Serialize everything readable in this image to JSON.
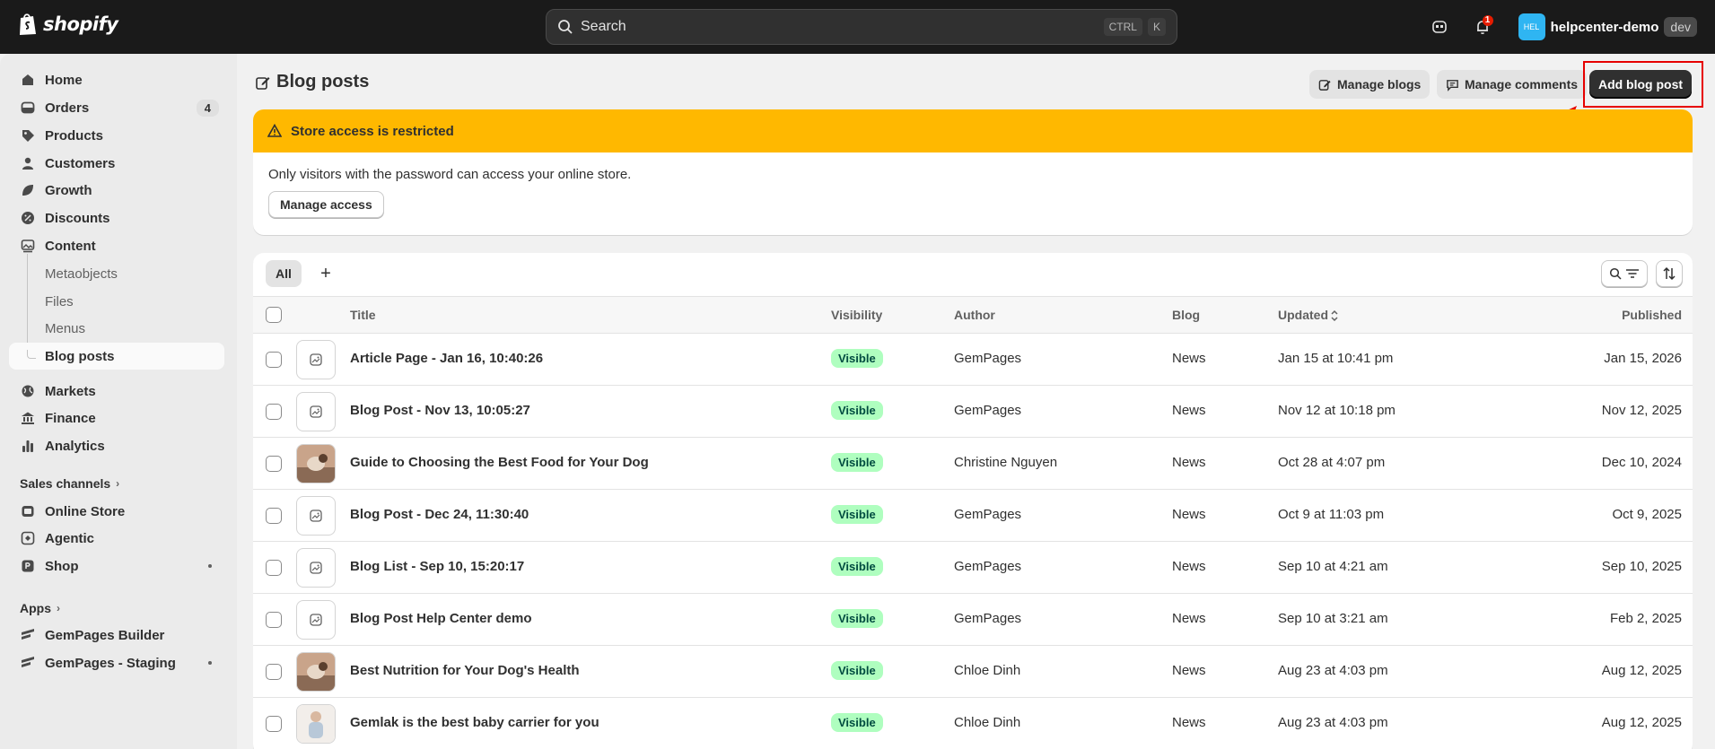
{
  "topbar": {
    "logo_text": "shopify",
    "search_placeholder": "Search",
    "kbd_ctrl": "CTRL",
    "kbd_k": "K",
    "notification_count": "1",
    "store_initials": "HEL",
    "store_name": "helpcenter-demo",
    "store_tag": "dev"
  },
  "sidebar": {
    "items": [
      {
        "label": "Home",
        "icon": "home-icon"
      },
      {
        "label": "Orders",
        "icon": "orders-icon",
        "badge": "4"
      },
      {
        "label": "Products",
        "icon": "tag-icon"
      },
      {
        "label": "Customers",
        "icon": "person-icon"
      },
      {
        "label": "Growth",
        "icon": "growth-icon"
      },
      {
        "label": "Discounts",
        "icon": "discount-icon"
      },
      {
        "label": "Content",
        "icon": "content-icon"
      }
    ],
    "content_sub": [
      "Metaobjects",
      "Files",
      "Menus",
      "Blog posts"
    ],
    "items2": [
      {
        "label": "Markets",
        "icon": "globe-icon"
      },
      {
        "label": "Finance",
        "icon": "bank-icon"
      },
      {
        "label": "Analytics",
        "icon": "chart-icon"
      }
    ],
    "sales_channels_label": "Sales channels",
    "channels": [
      {
        "label": "Online Store",
        "icon": "store-icon"
      },
      {
        "label": "Agentic",
        "icon": "agentic-icon"
      },
      {
        "label": "Shop",
        "icon": "shop-icon"
      }
    ],
    "apps_label": "Apps",
    "apps": [
      {
        "label": "GemPages Builder",
        "icon": "gempages-icon"
      },
      {
        "label": "GemPages - Staging",
        "icon": "gempages-icon"
      }
    ]
  },
  "page": {
    "title": "Blog posts",
    "manage_blogs": "Manage blogs",
    "manage_comments": "Manage comments",
    "add_blog_post": "Add blog post"
  },
  "banner": {
    "title": "Store access is restricted",
    "body": "Only visitors with the password can access your online store.",
    "button": "Manage access"
  },
  "table": {
    "tab_all": "All",
    "tab_add": "+",
    "headers": {
      "title": "Title",
      "visibility": "Visibility",
      "author": "Author",
      "blog": "Blog",
      "updated": "Updated",
      "published": "Published"
    },
    "rows": [
      {
        "title": "Article Page - Jan 16, 10:40:26",
        "visibility": "Visible",
        "author": "GemPages",
        "blog": "News",
        "updated": "Jan 15 at 10:41 pm",
        "published": "Jan 15, 2026",
        "thumb": "placeholder"
      },
      {
        "title": "Blog Post - Nov 13, 10:05:27",
        "visibility": "Visible",
        "author": "GemPages",
        "blog": "News",
        "updated": "Nov 12 at 10:18 pm",
        "published": "Nov 12, 2025",
        "thumb": "placeholder"
      },
      {
        "title": "Guide to Choosing the Best Food for Your Dog",
        "visibility": "Visible",
        "author": "Christine Nguyen",
        "blog": "News",
        "updated": "Oct 28 at 4:07 pm",
        "published": "Dec 10, 2024",
        "thumb": "dog-photo"
      },
      {
        "title": "Blog Post - Dec 24, 11:30:40",
        "visibility": "Visible",
        "author": "GemPages",
        "blog": "News",
        "updated": "Oct 9 at 11:03 pm",
        "published": "Oct 9, 2025",
        "thumb": "placeholder"
      },
      {
        "title": "Blog List - Sep 10, 15:20:17",
        "visibility": "Visible",
        "author": "GemPages",
        "blog": "News",
        "updated": "Sep 10 at 4:21 am",
        "published": "Sep 10, 2025",
        "thumb": "placeholder"
      },
      {
        "title": "Blog Post Help Center demo",
        "visibility": "Visible",
        "author": "GemPages",
        "blog": "News",
        "updated": "Sep 10 at 3:21 am",
        "published": "Feb 2, 2025",
        "thumb": "placeholder"
      },
      {
        "title": "Best Nutrition for Your Dog's Health",
        "visibility": "Visible",
        "author": "Chloe Dinh",
        "blog": "News",
        "updated": "Aug 23 at 4:03 pm",
        "published": "Aug 12, 2025",
        "thumb": "dog-photo"
      },
      {
        "title": "Gemlak is the best baby carrier for you",
        "visibility": "Visible",
        "author": "Chloe Dinh",
        "blog": "News",
        "updated": "Aug 23 at 4:03 pm",
        "published": "Aug 12, 2025",
        "thumb": "baby-photo"
      }
    ]
  },
  "colors": {
    "topbar": "#1a1a1a",
    "banner": "#ffb800",
    "badge_visible_bg": "#affebf",
    "badge_visible_fg": "#014b40",
    "annotation_red": "#e60000"
  }
}
